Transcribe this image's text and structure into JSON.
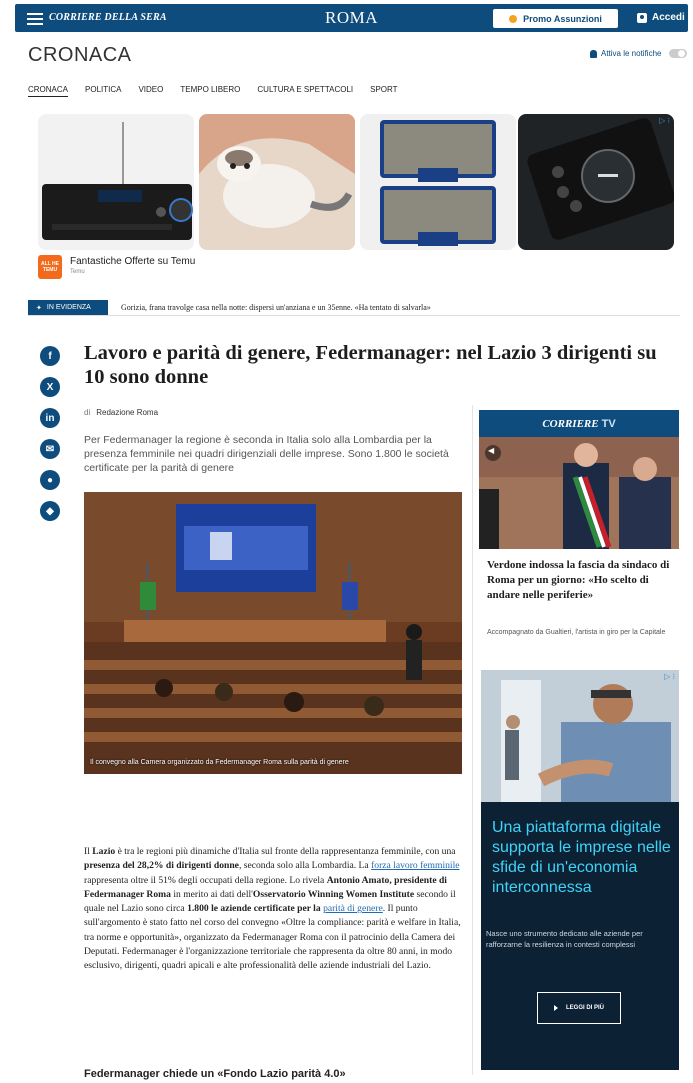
{
  "header": {
    "brand": "CORRIERE DELLA SERA",
    "city": "ROMA",
    "promo_label": "Promo Assunzioni",
    "login_label": "Accedi"
  },
  "section": {
    "title": "CRONACA",
    "notify_label": "Attiva le notifiche",
    "nav": [
      "CRONACA",
      "POLITICA",
      "VIDEO",
      "TEMPO LIBERO",
      "CULTURA E SPETTACOLI",
      "SPORT"
    ]
  },
  "ad": {
    "logo_text": "ALL HE TEMU",
    "title": "Fantastiche Offerte su Temu",
    "source": "Temu",
    "info_icon": "ad-choices-icon"
  },
  "evidenza": {
    "tag": "IN EVIDENZA",
    "text": "Gorizia, frana travolge casa nella notte: dispersi un'anziana e un 35enne. «Ha tentato di salvarla»"
  },
  "share": [
    "f",
    "X",
    "in",
    "✉",
    "●",
    "◆"
  ],
  "article": {
    "headline": "Lavoro e parità di genere, Federmanager: nel Lazio 3 dirigenti su 10 sono donne",
    "by_prefix": "di",
    "author": "Redazione Roma",
    "summary": "Per Federmanager la regione è seconda in Italia solo alla Lombardia per la presenza femminile nei quadri dirigenziali delle imprese. Sono 1.800 le società certificate per la parità di genere",
    "image_caption": "Il convegno alla Camera organizzato da Federmanager Roma sulla parità di genere",
    "body": {
      "p1": "Il ",
      "b1": "Lazio",
      "p2": " è tra le regioni più dinamiche d'Italia sul fronte della rappresentanza femminile, con una ",
      "b2": "presenza del 28,2% di dirigenti donne",
      "p3": ", seconda solo alla Lombardia. La ",
      "l1": "forza lavoro femminile",
      "p4": " rappresenta oltre il 51% degli occupati della regione. Lo rivela ",
      "b3": "Antonio Amato, presidente di Federmanager Roma",
      "p5": " in merito ai dati dell'",
      "b4": "Osservatorio Winning Women Institute",
      "p6": " secondo il quale nel Lazio sono circa ",
      "b5": "1.800 le aziende certificate per la",
      "l2": "parità di genere",
      "p7": ". Il punto sull'argomento è stato fatto nel corso del convegno «Oltre la compliance: parità e welfare in Italia, tra norme e opportunità», organizzato da Federmanager Roma con il patrocinio della Camera dei Deputati. Federmanager è l'organizzazione territoriale che rappresenta da oltre 80 anni, in modo esclusivo, dirigenti, quadri apicali e alte professionalità delle aziende industriali del Lazio."
    },
    "subhead": "Federmanager chiede un «Fondo Lazio parità 4.0»"
  },
  "tv": {
    "brand": "CORRIERE",
    "brand_suffix": "TV",
    "title": "Verdone indossa la fascia da sindaco di Roma per un giorno: «Ho scelto di andare nelle periferie»",
    "subtitle": "Accompagnato da Gualtieri, l'artista in giro per la Capitale"
  },
  "right_ad": {
    "headline": "Una piattaforma digitale supporta le imprese nelle sfide di un'economia interconnessa",
    "sub": "Nasce uno strumento dedicato alle aziende per rafforzarne la resilienza in contesti complessi",
    "button": "LEGGI DI PIÙ"
  },
  "colors": {
    "brand_blue": "#0d4c7c",
    "ad_cyan": "#3fd3f7",
    "link": "#1e6ab4"
  }
}
